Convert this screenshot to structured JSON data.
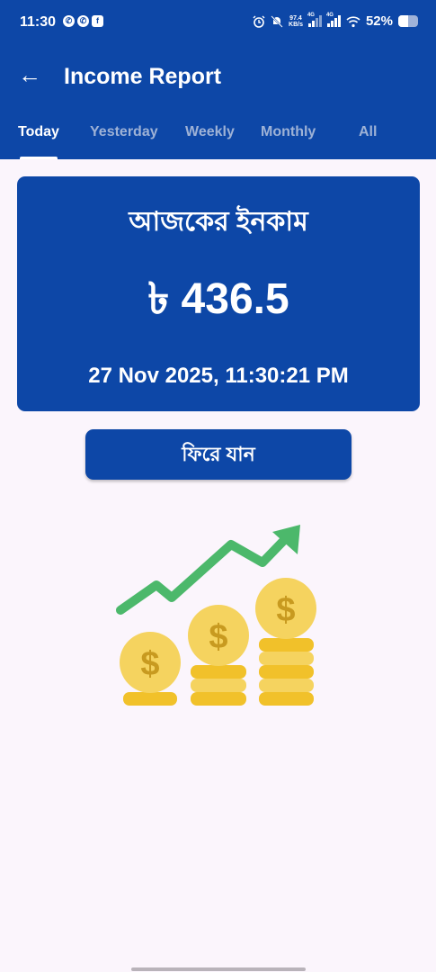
{
  "status_bar": {
    "time": "11:30",
    "netspeed_top": "97.4",
    "netspeed_bottom": "KB/s",
    "sig1_label": "4G",
    "sig2_label": "4G",
    "battery": "52%",
    "battery_level": 0.52
  },
  "header": {
    "title": "Income Report",
    "back_icon": "arrow-left-icon"
  },
  "tabs": [
    {
      "label": "Today",
      "active": true
    },
    {
      "label": "Yesterday",
      "active": false
    },
    {
      "label": "Weekly",
      "active": false
    },
    {
      "label": "Monthly",
      "active": false
    },
    {
      "label": "All",
      "active": false
    }
  ],
  "income_card": {
    "title": "আজকের ইনকাম",
    "amount": "৳ 436.5",
    "datetime": "27 Nov 2025, 11:30:21 PM"
  },
  "back_button": {
    "label": "ফিরে যান"
  },
  "colors": {
    "primary": "#0d47a7",
    "background": "#fbf5fc",
    "coin": "#f1c12a",
    "arrow": "#4cb86b"
  }
}
